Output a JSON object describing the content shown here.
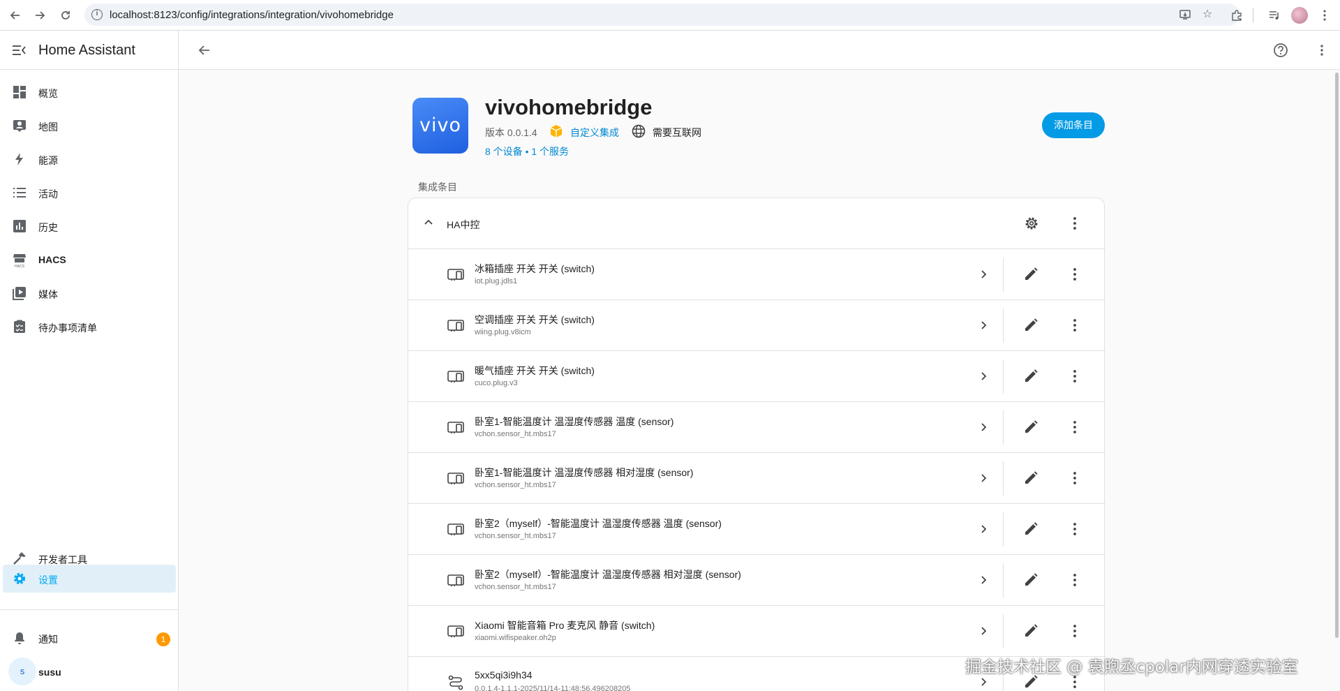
{
  "browser": {
    "url": "localhost:8123/config/integrations/integration/vivohomebridge"
  },
  "sidebar": {
    "title": "Home Assistant",
    "items": [
      {
        "label": "概览",
        "icon": "dashboard-icon"
      },
      {
        "label": "地图",
        "icon": "map-icon"
      },
      {
        "label": "能源",
        "icon": "lightning-icon"
      },
      {
        "label": "活动",
        "icon": "list-icon"
      },
      {
        "label": "历史",
        "icon": "chart-icon"
      },
      {
        "label": "HACS",
        "icon": "hacs-icon"
      },
      {
        "label": "媒体",
        "icon": "media-icon"
      },
      {
        "label": "待办事项清单",
        "icon": "clipboard-icon"
      }
    ],
    "bottom_items": [
      {
        "label": "开发者工具",
        "icon": "hammer-icon"
      },
      {
        "label": "设置",
        "icon": "gear-icon",
        "active": true
      }
    ],
    "notifications": {
      "label": "通知",
      "count": "1"
    },
    "user": {
      "initial": "s",
      "name": "susu"
    }
  },
  "integration": {
    "logo_text": "vivo",
    "title": "vivohomebridge",
    "version": "版本 0.0.1.4",
    "custom_label": "自定义集成",
    "internet_label": "需要互联网",
    "devices_link": "8 个设备 • 1 个服务",
    "add_entry_label": "添加条目",
    "section_title": "集成条目"
  },
  "entry": {
    "title": "HA中控",
    "devices": [
      {
        "name": "冰箱插座 开关 开关 (switch)",
        "model": "iot.plug.jdls1",
        "icon": "device-icon"
      },
      {
        "name": "空调插座 开关 开关 (switch)",
        "model": "wiing.plug.v8icm",
        "icon": "device-icon"
      },
      {
        "name": "暖气插座 开关 开关 (switch)",
        "model": "cuco.plug.v3",
        "icon": "device-icon"
      },
      {
        "name": "卧室1-智能温度计 温湿度传感器 温度 (sensor)",
        "model": "vchon.sensor_ht.mbs17",
        "icon": "device-icon"
      },
      {
        "name": "卧室1-智能温度计 温湿度传感器 相对湿度 (sensor)",
        "model": "vchon.sensor_ht.mbs17",
        "icon": "device-icon"
      },
      {
        "name": "卧室2（myself）-智能温度计 温湿度传感器 温度 (sensor)",
        "model": "vchon.sensor_ht.mbs17",
        "icon": "device-icon"
      },
      {
        "name": "卧室2（myself）-智能温度计 温湿度传感器 相对湿度 (sensor)",
        "model": "vchon.sensor_ht.mbs17",
        "icon": "device-icon"
      },
      {
        "name": "Xiaomi 智能音箱 Pro 麦克风 静音 (switch)",
        "model": "xiaomi.wifispeaker.oh2p",
        "icon": "device-icon"
      },
      {
        "name": "5xx5qi3i9h34",
        "model": "0.0.1.4-1.1.1-2025/11/14-11:48:56.496208205",
        "icon": "service-icon"
      }
    ]
  },
  "watermark": "掘金技术社区 @ 袁煦丞cpolar内网穿透实验室"
}
